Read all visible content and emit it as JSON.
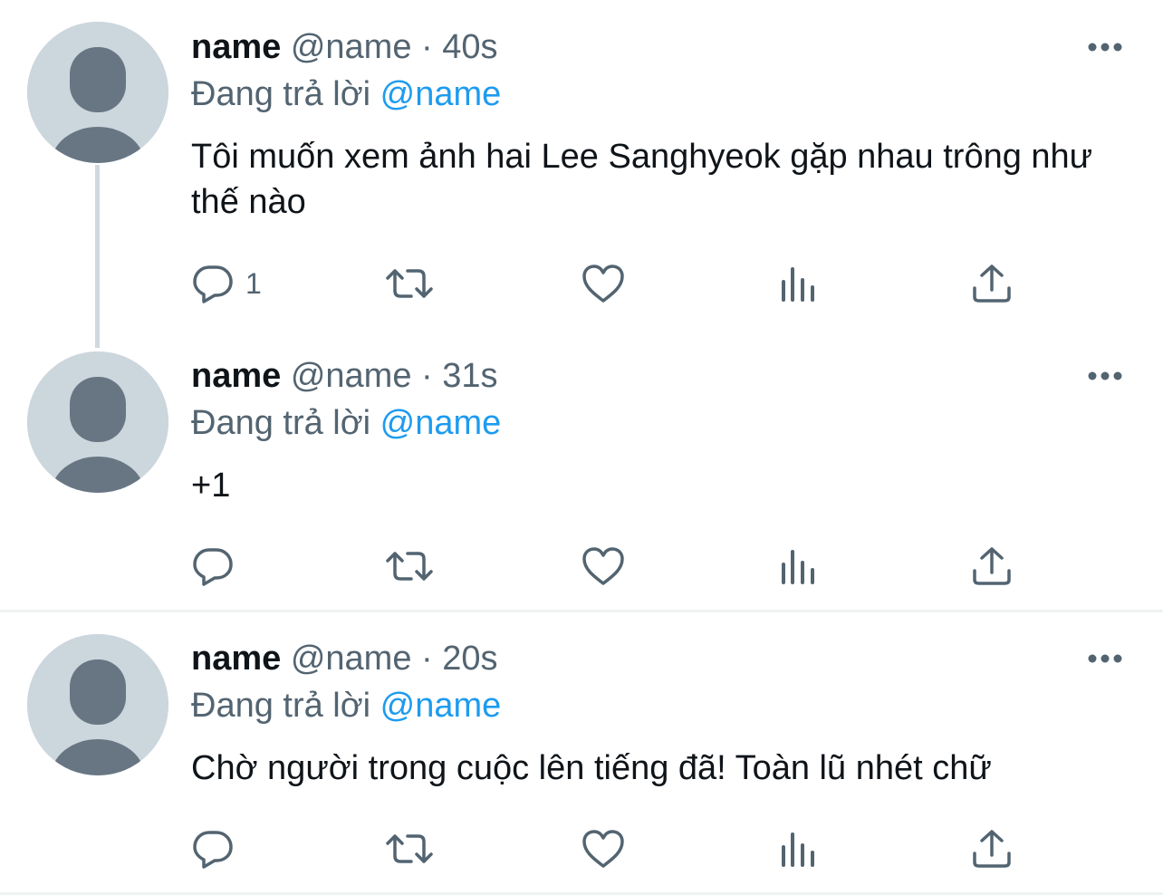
{
  "tweets": [
    {
      "name": "name",
      "handle": "@name",
      "separator": "·",
      "time": "40s",
      "replying_prefix": "Đang trả lời",
      "replying_to": "@name",
      "text": "Tôi muốn xem ảnh hai Lee Sanghyeok gặp nhau trông như thế nào",
      "reply_count": "1"
    },
    {
      "name": "name",
      "handle": "@name",
      "separator": "·",
      "time": "31s",
      "replying_prefix": "Đang trả lời",
      "replying_to": "@name",
      "text": "+1",
      "reply_count": ""
    },
    {
      "name": "name",
      "handle": "@name",
      "separator": "·",
      "time": "20s",
      "replying_prefix": "Đang trả lời",
      "replying_to": "@name",
      "text": "Chờ người trong cuộc lên tiếng đã! Toàn lũ nhét chữ",
      "reply_count": ""
    }
  ],
  "icons": {
    "reply": "reply-icon",
    "retweet": "retweet-icon",
    "like": "heart-icon",
    "analytics": "analytics-icon",
    "share": "share-icon",
    "more": "more-icon",
    "avatar": "default-avatar-icon"
  },
  "colors": {
    "text_primary": "#0f1419",
    "text_secondary": "#536471",
    "accent": "#1d9bf0",
    "avatar_bg": "#ccd6dd",
    "avatar_fg": "#687684",
    "thread_line": "#cfd9de",
    "divider": "#eff3f4"
  }
}
